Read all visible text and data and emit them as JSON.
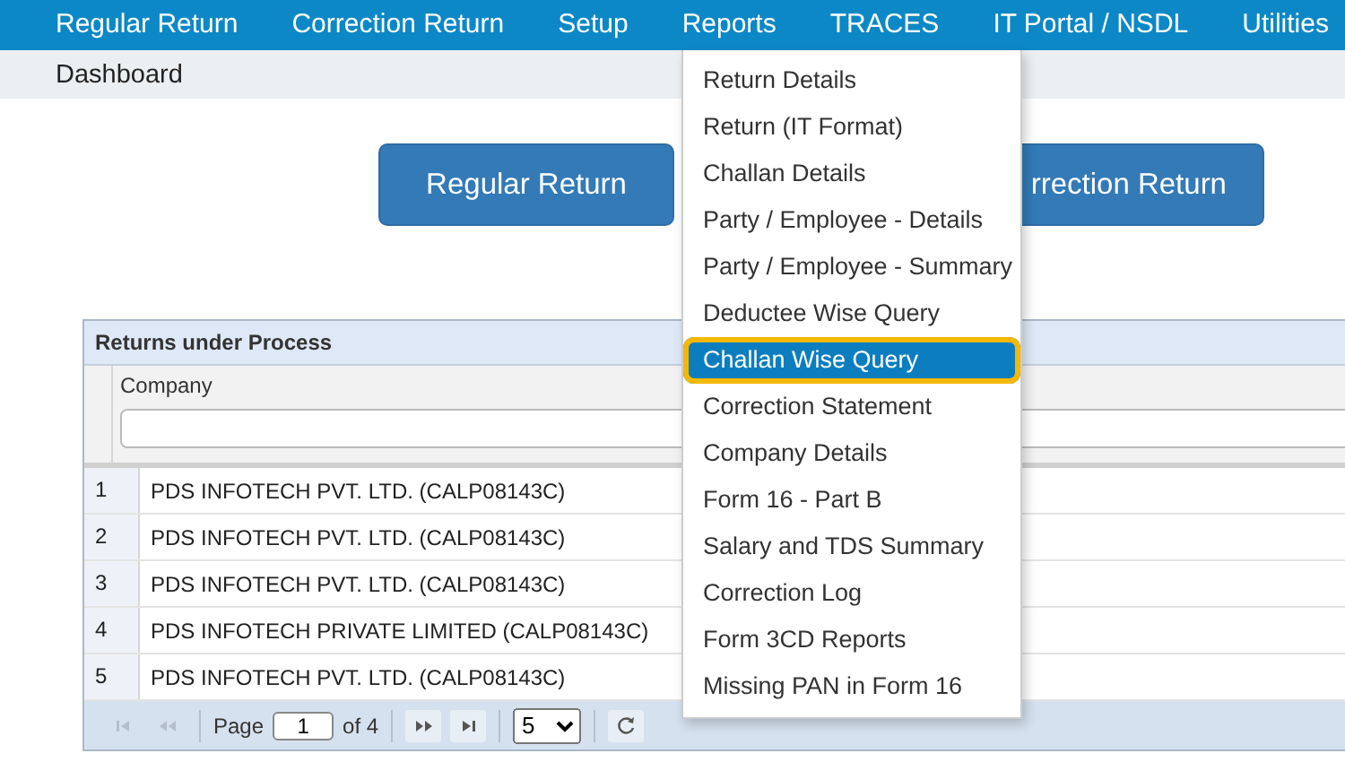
{
  "nav": {
    "items": [
      {
        "label": "Regular Return"
      },
      {
        "label": "Correction Return"
      },
      {
        "label": "Setup"
      },
      {
        "label": "Reports"
      },
      {
        "label": "TRACES"
      },
      {
        "label": "IT Portal / NSDL"
      },
      {
        "label": "Utilities"
      }
    ]
  },
  "breadcrumb": "Dashboard",
  "buttons": [
    "Regular Return",
    "rrection Return"
  ],
  "menu": {
    "items": [
      {
        "label": "Return Details",
        "selected": false
      },
      {
        "label": "Return (IT Format)",
        "selected": false
      },
      {
        "label": "Challan Details",
        "selected": false
      },
      {
        "label": "Party / Employee - Details",
        "selected": false
      },
      {
        "label": "Party / Employee - Summary",
        "selected": false
      },
      {
        "label": "Deductee Wise Query",
        "selected": false
      },
      {
        "label": "Challan Wise Query",
        "selected": true
      },
      {
        "label": "Correction Statement",
        "selected": false
      },
      {
        "label": "Company Details",
        "selected": false
      },
      {
        "label": "Form 16 - Part B",
        "selected": false
      },
      {
        "label": "Salary and TDS Summary",
        "selected": false
      },
      {
        "label": "Correction Log",
        "selected": false
      },
      {
        "label": "Form 3CD Reports",
        "selected": false
      },
      {
        "label": "Missing PAN in Form 16",
        "selected": false
      }
    ]
  },
  "grid": {
    "title": "Returns under Process",
    "column": "Company",
    "rows": [
      {
        "number": "1",
        "company": "PDS INFOTECH PVT. LTD. (CALP08143C)"
      },
      {
        "number": "2",
        "company": "PDS INFOTECH PVT. LTD. (CALP08143C)"
      },
      {
        "number": "3",
        "company": "PDS INFOTECH PVT. LTD. (CALP08143C)"
      },
      {
        "number": "4",
        "company": "PDS INFOTECH PRIVATE LIMITED (CALP08143C)"
      },
      {
        "number": "5",
        "company": "PDS INFOTECH PVT. LTD. (CALP08143C)"
      }
    ],
    "pager": {
      "page_label": "Page",
      "page": "1",
      "of": "of 4",
      "page_size": "5",
      "first_disabled": true,
      "prev_disabled": true,
      "next_disabled": false,
      "last_disabled": false
    }
  }
}
